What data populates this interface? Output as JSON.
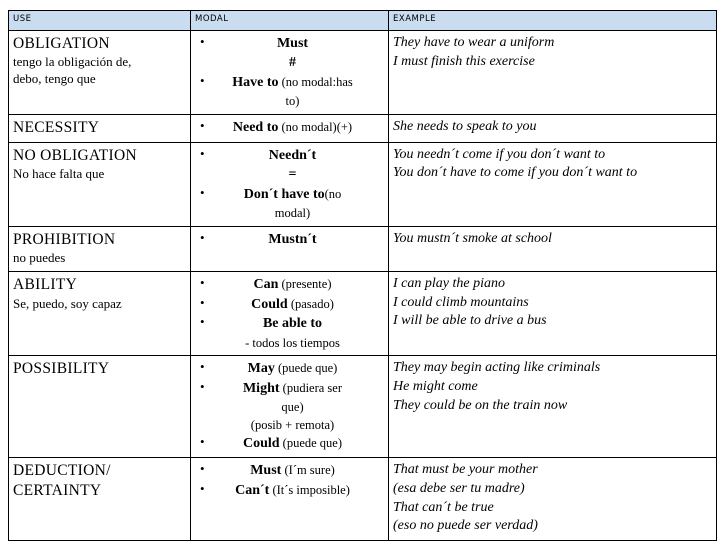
{
  "table": {
    "headers": {
      "use": "USE",
      "modal": "MODAL",
      "example": "EXAMPLE"
    },
    "rows": [
      {
        "use_title": " OBLIGATION",
        "use_sub": "tengo la obligación de,\ndebo, tengo que",
        "modal_items": [
          {
            "bullet": true,
            "text": "Must",
            "note": "",
            "center": true
          },
          {
            "bullet": false,
            "text": "#",
            "note": "",
            "center": true
          },
          {
            "bullet": true,
            "text": "Have to",
            "note": " (no modal:has to)",
            "center": true
          }
        ],
        "examples": "They have to wear a uniform\nI must finish this exercise"
      },
      {
        "use_title": "NECESSITY",
        "use_sub": "",
        "modal_items": [
          {
            "bullet": true,
            "text": "Need to",
            "note": " (no modal)(+)",
            "center": true
          }
        ],
        "examples": "She needs to speak to you"
      },
      {
        "use_title": "NO OBLIGATION",
        "use_sub": "No hace falta que",
        "modal_items": [
          {
            "bullet": true,
            "text": "Needn´t",
            "note": "",
            "center": true
          },
          {
            "bullet": false,
            "text": "=",
            "note": "",
            "center": true
          },
          {
            "bullet": true,
            "text": "Don´t have to",
            "note": "(no modal)",
            "center": true
          }
        ],
        "examples": "You needn´t come if you don´t want to\nYou don´t have to come if you don´t want to"
      },
      {
        "use_title": "PROHIBITION",
        "use_sub": "no puedes",
        "modal_items": [
          {
            "bullet": true,
            "text": "Mustn´t",
            "note": "",
            "center": true
          }
        ],
        "examples": "You mustn´t smoke at school"
      },
      {
        "use_title": "ABILITY",
        "use_sub": "Se, puedo, soy capaz",
        "modal_items": [
          {
            "bullet": true,
            "text": "Can",
            "note": "  (presente)",
            "center": true
          },
          {
            "bullet": true,
            "text": "Could",
            "note": "  (pasado)",
            "center": true
          },
          {
            "bullet": true,
            "text": "Be able to",
            "note": "",
            "center": true
          },
          {
            "bullet": false,
            "text": "",
            "note": "- todos los tiempos",
            "center": true
          }
        ],
        "examples": "I can play the piano\nI could climb mountains\nI will be able to drive a bus"
      },
      {
        "use_title": "POSSIBILITY",
        "use_sub": "",
        "modal_items": [
          {
            "bullet": true,
            "text": "May",
            "note": "  (puede que)",
            "center": true
          },
          {
            "bullet": true,
            "text": "Might",
            "note": " (pudiera ser que)",
            "center": true
          },
          {
            "bullet": false,
            "text": "",
            "note": "(posib + remota)",
            "center": true
          },
          {
            "bullet": true,
            "text": "Could",
            "note": "  (puede que)",
            "center": true
          }
        ],
        "examples": "They may begin acting like criminals\n He might come\nThey could be on the train now"
      },
      {
        "use_title": "DEDUCTION/\nCERTAINTY",
        "use_sub": "",
        "modal_items": [
          {
            "bullet": true,
            "text": "Must",
            "note": " (I´m sure)",
            "center": true
          },
          {
            "bullet": true,
            "text": "Can´t",
            "note": " (It´s imposible)",
            "center": true
          }
        ],
        "examples": "That must be your mother\n(esa debe ser tu madre)\nThat can´t be true\n(eso no puede ser verdad)"
      }
    ]
  },
  "colors": {
    "header_bg": "#c9dcf0",
    "border": "#000000",
    "text": "#000000"
  }
}
